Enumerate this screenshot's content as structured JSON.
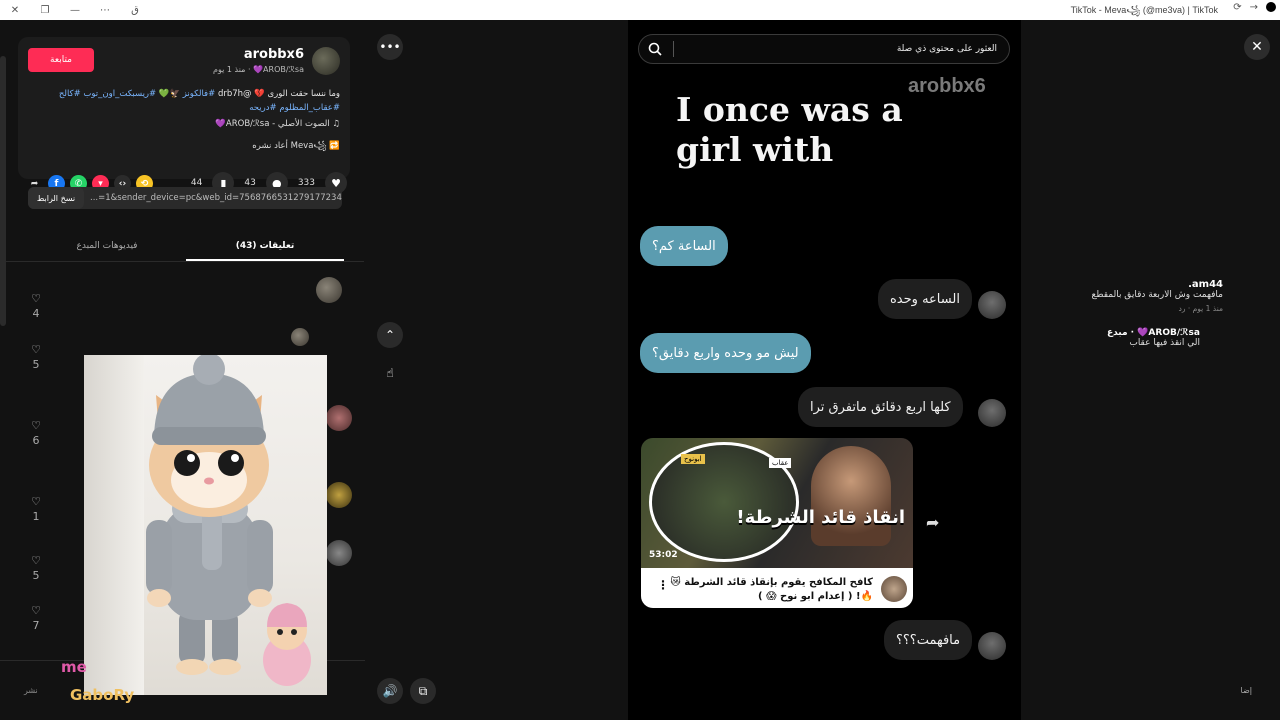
{
  "window": {
    "title": "TikTok - Meva꧁ (@me3va) | TikTok",
    "left_icon_label": "ق"
  },
  "post": {
    "author": "arobbx6",
    "author_sub": "AROB/ℛsa💜 · منذ 1 يوم",
    "follow_label": "متابعة",
    "caption_text": "وما ننسا حقت الورى 💔 @drb7h ",
    "caption_tags_line1": "#فالكونز 🦅💚 #ريسبكت_اون_توب #كالح",
    "caption_tags_line2": "#عقاب_المظلوم #دريحه",
    "sound": "الصوت الأصلي - AROB/ℛsa💜",
    "reposted": "Meva꧁ أعاد نشره",
    "likes": "333",
    "comments_count": "43",
    "saves": "44",
    "link": "...=1&sender_device=pc&web_id=7568766531279177234",
    "copy_link_label": "نسخ الرابط"
  },
  "tabs": [
    {
      "label": "تعليقات (43)"
    },
    {
      "label": "فيديوهات المبدع"
    }
  ],
  "comments": [
    {
      "user": "am44.",
      "text": "مافهمت وش الاربعة دقايق بالمقطع",
      "meta": "منذ 1 يوم  ·  رد",
      "likes": "4"
    },
    {
      "user": "AROB/ℛsa💜 · مبدع",
      "text": "الي انقذ فيها عقاب",
      "likes": "5"
    }
  ],
  "like_counts": [
    "6",
    "1",
    "5",
    "7"
  ],
  "overlay": {
    "line1": "me",
    "line2": "GaboRy"
  },
  "bottom": {
    "post_label": "نشر",
    "at_label": "إضا"
  },
  "video": {
    "search_placeholder": "العثور على محتوى ذي صلة",
    "watermark": "arobbx6",
    "headline": "I once was a girl with",
    "bubbles": [
      {
        "text": "الساعة كم؟"
      },
      {
        "text": "الساعه وحده"
      },
      {
        "text": "ليش مو وحده واربع دقايق؟"
      },
      {
        "text": "كلها اربع دقائق ماتفرق ترا"
      },
      {
        "text": "مافهمت؟؟؟"
      }
    ],
    "card": {
      "image_title": "انقاذ قائد الشرطة!",
      "duration": "53:02",
      "title": "كافح المكافح يقوم بإنقاذ قائد الشرطة 😿🔥! ( إعدام ابو نوح 😱 )",
      "tag1": "عقاب",
      "tag2": "ابونوح"
    }
  },
  "colors": {
    "accent": "#fe2c55",
    "blue_bubble": "#5b9cb0",
    "hashtag": "#7ab6ff"
  }
}
